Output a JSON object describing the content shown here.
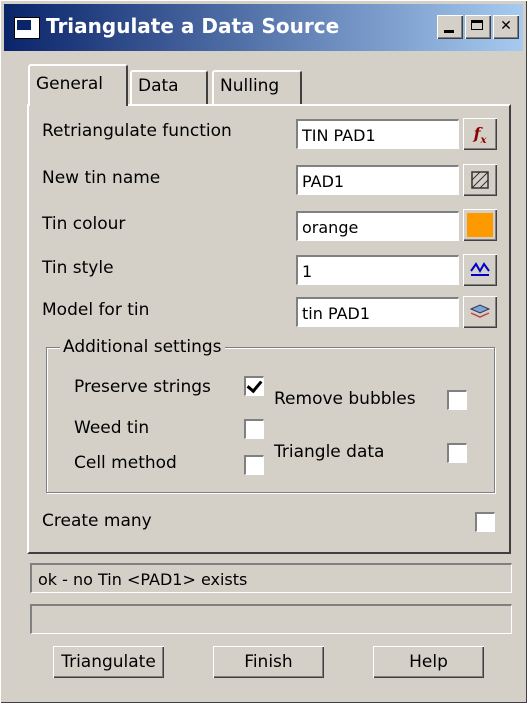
{
  "window": {
    "title": "Triangulate a Data Source"
  },
  "tabs": [
    {
      "label": "General",
      "active": true
    },
    {
      "label": "Data",
      "active": false
    },
    {
      "label": "Nulling",
      "active": false
    }
  ],
  "fields": {
    "retriangulate": {
      "label": "Retriangulate function",
      "value": "TIN PAD1",
      "icon": "function-icon"
    },
    "new_tin_name": {
      "label": "New tin name",
      "value": "PAD1",
      "icon": "tin-select-icon"
    },
    "tin_colour": {
      "label": "Tin colour",
      "value": "orange",
      "color": "#ff9900"
    },
    "tin_style": {
      "label": "Tin style",
      "value": "1",
      "icon": "style-icon"
    },
    "model_for_tin": {
      "label": "Model for tin",
      "value": "tin PAD1",
      "icon": "layers-icon"
    }
  },
  "additional": {
    "legend": "Additional settings",
    "preserve_strings": {
      "label": "Preserve strings",
      "checked": true
    },
    "weed_tin": {
      "label": "Weed tin",
      "checked": false
    },
    "cell_method": {
      "label": "Cell method",
      "checked": false
    },
    "remove_bubbles": {
      "label": "Remove bubbles",
      "checked": false
    },
    "triangle_data": {
      "label": "Triangle data",
      "checked": false
    }
  },
  "create_many": {
    "label": "Create many",
    "checked": false
  },
  "status": {
    "message": "ok - no Tin <PAD1> exists",
    "secondary": ""
  },
  "buttons": {
    "triangulate": "Triangulate",
    "finish": "Finish",
    "help": "Help"
  }
}
